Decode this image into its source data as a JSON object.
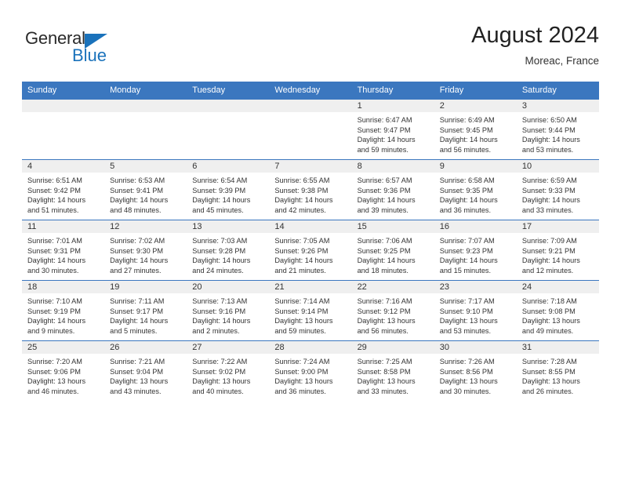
{
  "brand": {
    "name_part1": "General",
    "name_part2": "Blue",
    "triangle_color": "#1a72bb"
  },
  "header": {
    "title": "August 2024",
    "subtitle": "Moreac, France"
  },
  "theme": {
    "header_bg": "#3b77bf",
    "daynum_bg": "#efefef",
    "grid_line": "#3b77bf",
    "text": "#333333"
  },
  "weekday_headers": [
    "Sunday",
    "Monday",
    "Tuesday",
    "Wednesday",
    "Thursday",
    "Friday",
    "Saturday"
  ],
  "weeks": [
    [
      {
        "day": "",
        "empty": true,
        "sunrise": "",
        "sunset": "",
        "daylight1": "",
        "daylight2": ""
      },
      {
        "day": "",
        "empty": true,
        "sunrise": "",
        "sunset": "",
        "daylight1": "",
        "daylight2": ""
      },
      {
        "day": "",
        "empty": true,
        "sunrise": "",
        "sunset": "",
        "daylight1": "",
        "daylight2": ""
      },
      {
        "day": "",
        "empty": true,
        "sunrise": "",
        "sunset": "",
        "daylight1": "",
        "daylight2": ""
      },
      {
        "day": "1",
        "empty": false,
        "sunrise": "Sunrise: 6:47 AM",
        "sunset": "Sunset: 9:47 PM",
        "daylight1": "Daylight: 14 hours",
        "daylight2": "and 59 minutes."
      },
      {
        "day": "2",
        "empty": false,
        "sunrise": "Sunrise: 6:49 AM",
        "sunset": "Sunset: 9:45 PM",
        "daylight1": "Daylight: 14 hours",
        "daylight2": "and 56 minutes."
      },
      {
        "day": "3",
        "empty": false,
        "sunrise": "Sunrise: 6:50 AM",
        "sunset": "Sunset: 9:44 PM",
        "daylight1": "Daylight: 14 hours",
        "daylight2": "and 53 minutes."
      }
    ],
    [
      {
        "day": "4",
        "empty": false,
        "sunrise": "Sunrise: 6:51 AM",
        "sunset": "Sunset: 9:42 PM",
        "daylight1": "Daylight: 14 hours",
        "daylight2": "and 51 minutes."
      },
      {
        "day": "5",
        "empty": false,
        "sunrise": "Sunrise: 6:53 AM",
        "sunset": "Sunset: 9:41 PM",
        "daylight1": "Daylight: 14 hours",
        "daylight2": "and 48 minutes."
      },
      {
        "day": "6",
        "empty": false,
        "sunrise": "Sunrise: 6:54 AM",
        "sunset": "Sunset: 9:39 PM",
        "daylight1": "Daylight: 14 hours",
        "daylight2": "and 45 minutes."
      },
      {
        "day": "7",
        "empty": false,
        "sunrise": "Sunrise: 6:55 AM",
        "sunset": "Sunset: 9:38 PM",
        "daylight1": "Daylight: 14 hours",
        "daylight2": "and 42 minutes."
      },
      {
        "day": "8",
        "empty": false,
        "sunrise": "Sunrise: 6:57 AM",
        "sunset": "Sunset: 9:36 PM",
        "daylight1": "Daylight: 14 hours",
        "daylight2": "and 39 minutes."
      },
      {
        "day": "9",
        "empty": false,
        "sunrise": "Sunrise: 6:58 AM",
        "sunset": "Sunset: 9:35 PM",
        "daylight1": "Daylight: 14 hours",
        "daylight2": "and 36 minutes."
      },
      {
        "day": "10",
        "empty": false,
        "sunrise": "Sunrise: 6:59 AM",
        "sunset": "Sunset: 9:33 PM",
        "daylight1": "Daylight: 14 hours",
        "daylight2": "and 33 minutes."
      }
    ],
    [
      {
        "day": "11",
        "empty": false,
        "sunrise": "Sunrise: 7:01 AM",
        "sunset": "Sunset: 9:31 PM",
        "daylight1": "Daylight: 14 hours",
        "daylight2": "and 30 minutes."
      },
      {
        "day": "12",
        "empty": false,
        "sunrise": "Sunrise: 7:02 AM",
        "sunset": "Sunset: 9:30 PM",
        "daylight1": "Daylight: 14 hours",
        "daylight2": "and 27 minutes."
      },
      {
        "day": "13",
        "empty": false,
        "sunrise": "Sunrise: 7:03 AM",
        "sunset": "Sunset: 9:28 PM",
        "daylight1": "Daylight: 14 hours",
        "daylight2": "and 24 minutes."
      },
      {
        "day": "14",
        "empty": false,
        "sunrise": "Sunrise: 7:05 AM",
        "sunset": "Sunset: 9:26 PM",
        "daylight1": "Daylight: 14 hours",
        "daylight2": "and 21 minutes."
      },
      {
        "day": "15",
        "empty": false,
        "sunrise": "Sunrise: 7:06 AM",
        "sunset": "Sunset: 9:25 PM",
        "daylight1": "Daylight: 14 hours",
        "daylight2": "and 18 minutes."
      },
      {
        "day": "16",
        "empty": false,
        "sunrise": "Sunrise: 7:07 AM",
        "sunset": "Sunset: 9:23 PM",
        "daylight1": "Daylight: 14 hours",
        "daylight2": "and 15 minutes."
      },
      {
        "day": "17",
        "empty": false,
        "sunrise": "Sunrise: 7:09 AM",
        "sunset": "Sunset: 9:21 PM",
        "daylight1": "Daylight: 14 hours",
        "daylight2": "and 12 minutes."
      }
    ],
    [
      {
        "day": "18",
        "empty": false,
        "sunrise": "Sunrise: 7:10 AM",
        "sunset": "Sunset: 9:19 PM",
        "daylight1": "Daylight: 14 hours",
        "daylight2": "and 9 minutes."
      },
      {
        "day": "19",
        "empty": false,
        "sunrise": "Sunrise: 7:11 AM",
        "sunset": "Sunset: 9:17 PM",
        "daylight1": "Daylight: 14 hours",
        "daylight2": "and 5 minutes."
      },
      {
        "day": "20",
        "empty": false,
        "sunrise": "Sunrise: 7:13 AM",
        "sunset": "Sunset: 9:16 PM",
        "daylight1": "Daylight: 14 hours",
        "daylight2": "and 2 minutes."
      },
      {
        "day": "21",
        "empty": false,
        "sunrise": "Sunrise: 7:14 AM",
        "sunset": "Sunset: 9:14 PM",
        "daylight1": "Daylight: 13 hours",
        "daylight2": "and 59 minutes."
      },
      {
        "day": "22",
        "empty": false,
        "sunrise": "Sunrise: 7:16 AM",
        "sunset": "Sunset: 9:12 PM",
        "daylight1": "Daylight: 13 hours",
        "daylight2": "and 56 minutes."
      },
      {
        "day": "23",
        "empty": false,
        "sunrise": "Sunrise: 7:17 AM",
        "sunset": "Sunset: 9:10 PM",
        "daylight1": "Daylight: 13 hours",
        "daylight2": "and 53 minutes."
      },
      {
        "day": "24",
        "empty": false,
        "sunrise": "Sunrise: 7:18 AM",
        "sunset": "Sunset: 9:08 PM",
        "daylight1": "Daylight: 13 hours",
        "daylight2": "and 49 minutes."
      }
    ],
    [
      {
        "day": "25",
        "empty": false,
        "sunrise": "Sunrise: 7:20 AM",
        "sunset": "Sunset: 9:06 PM",
        "daylight1": "Daylight: 13 hours",
        "daylight2": "and 46 minutes."
      },
      {
        "day": "26",
        "empty": false,
        "sunrise": "Sunrise: 7:21 AM",
        "sunset": "Sunset: 9:04 PM",
        "daylight1": "Daylight: 13 hours",
        "daylight2": "and 43 minutes."
      },
      {
        "day": "27",
        "empty": false,
        "sunrise": "Sunrise: 7:22 AM",
        "sunset": "Sunset: 9:02 PM",
        "daylight1": "Daylight: 13 hours",
        "daylight2": "and 40 minutes."
      },
      {
        "day": "28",
        "empty": false,
        "sunrise": "Sunrise: 7:24 AM",
        "sunset": "Sunset: 9:00 PM",
        "daylight1": "Daylight: 13 hours",
        "daylight2": "and 36 minutes."
      },
      {
        "day": "29",
        "empty": false,
        "sunrise": "Sunrise: 7:25 AM",
        "sunset": "Sunset: 8:58 PM",
        "daylight1": "Daylight: 13 hours",
        "daylight2": "and 33 minutes."
      },
      {
        "day": "30",
        "empty": false,
        "sunrise": "Sunrise: 7:26 AM",
        "sunset": "Sunset: 8:56 PM",
        "daylight1": "Daylight: 13 hours",
        "daylight2": "and 30 minutes."
      },
      {
        "day": "31",
        "empty": false,
        "sunrise": "Sunrise: 7:28 AM",
        "sunset": "Sunset: 8:55 PM",
        "daylight1": "Daylight: 13 hours",
        "daylight2": "and 26 minutes."
      }
    ]
  ]
}
